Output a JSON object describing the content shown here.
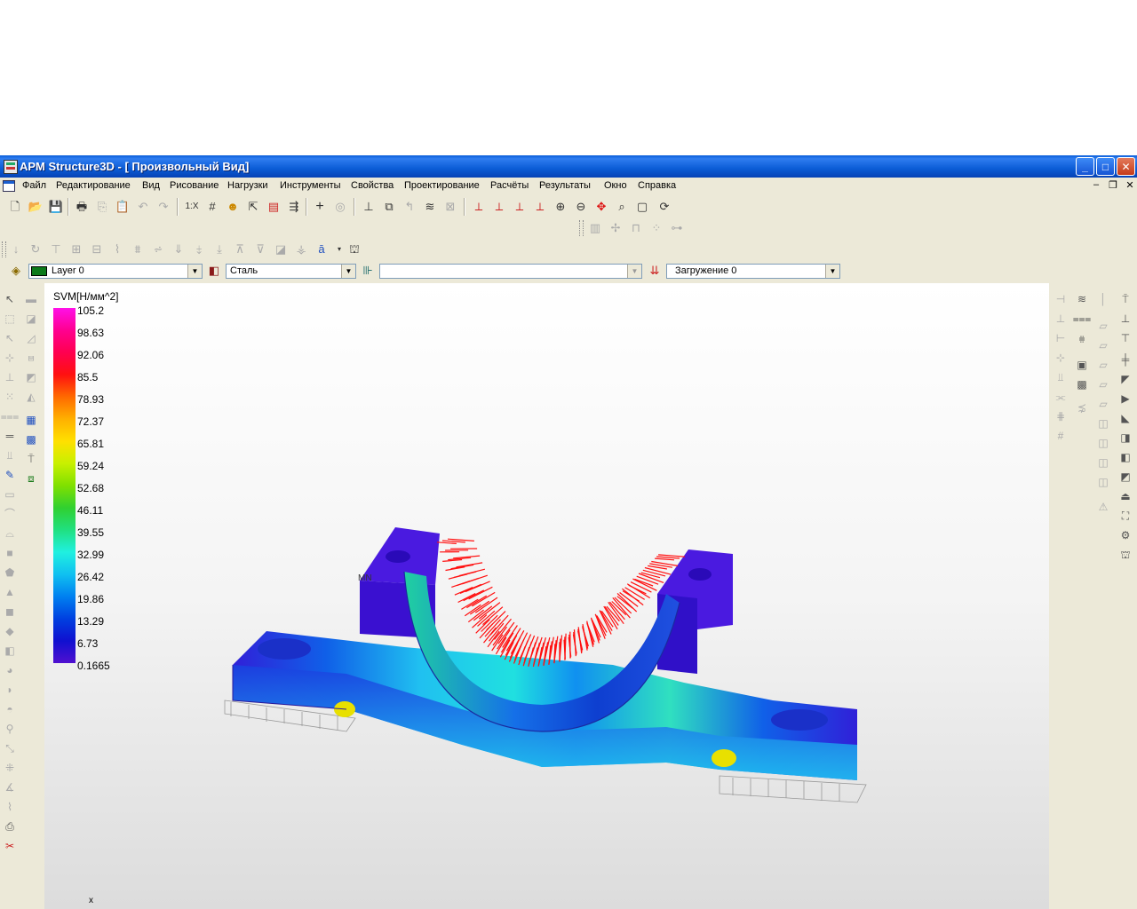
{
  "window": {
    "title": "APM Structure3D - [ Произвольный Вид]",
    "controls": {
      "minimize": "_",
      "maximize": "□",
      "close": "✕"
    }
  },
  "menu": {
    "items": [
      "Файл",
      "Редактирование",
      "Вид",
      "Рисование",
      "Нагрузки",
      "Инструменты",
      "Свойства",
      "Проектирование",
      "Расчёты",
      "Результаты",
      "Окно",
      "Справка"
    ],
    "mdi_controls": [
      "–",
      "❐",
      "✕"
    ]
  },
  "combos": {
    "layer": "Layer 0",
    "material": "Сталь",
    "section": "",
    "load_case": "Загружение 0"
  },
  "legend": {
    "title": "SVM[Н/мм^2]",
    "values": [
      "105.2",
      "98.63",
      "92.06",
      "85.5",
      "78.93",
      "72.37",
      "65.81",
      "59.24",
      "52.68",
      "46.11",
      "39.55",
      "32.99",
      "26.42",
      "19.86",
      "13.29",
      "6.73",
      "0.1665"
    ],
    "colors": [
      "#ff10e8",
      "#ff0090",
      "#ff0050",
      "#ff1010",
      "#ff6a00",
      "#ffb000",
      "#ffe000",
      "#c8f000",
      "#80e000",
      "#30d030",
      "#20e080",
      "#20f0e0",
      "#10c0f0",
      "#0080f0",
      "#0040e0",
      "#1010d0",
      "#5010d0"
    ]
  },
  "viewport": {
    "node_label": "MN",
    "axis_label": "x"
  }
}
